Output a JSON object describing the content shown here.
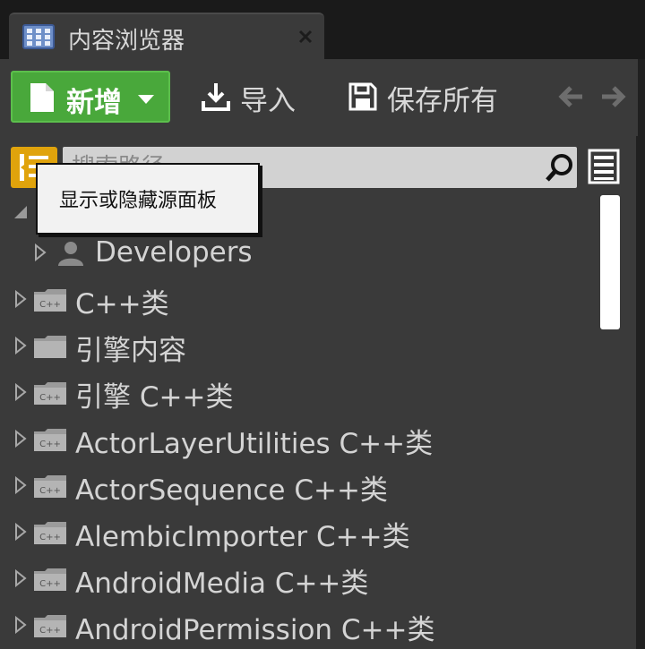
{
  "tab": {
    "title": "内容浏览器"
  },
  "toolbar": {
    "new_label": "新增",
    "import_label": "导入",
    "save_all_label": "保存所有"
  },
  "search": {
    "placeholder": "搜索路径"
  },
  "tooltip": {
    "text": "显示或隐藏源面板"
  },
  "tree": {
    "developers": "Developers",
    "items": [
      {
        "label": "C++类",
        "icon": "cpp-folder-icon"
      },
      {
        "label": "引擎内容",
        "icon": "folder-icon"
      },
      {
        "label": "引擎 C++类",
        "icon": "cpp-folder-icon"
      },
      {
        "label": "ActorLayerUtilities C++类",
        "icon": "cpp-folder-icon"
      },
      {
        "label": "ActorSequence C++类",
        "icon": "cpp-folder-icon"
      },
      {
        "label": "AlembicImporter C++类",
        "icon": "cpp-folder-icon"
      },
      {
        "label": "AndroidMedia C++类",
        "icon": "cpp-folder-icon"
      },
      {
        "label": "AndroidPermission C++类",
        "icon": "cpp-folder-icon"
      }
    ]
  },
  "colors": {
    "accent_green": "#49a83b",
    "source_toggle": "#e0a30c",
    "panel_bg": "#3a3a3a",
    "tab_bar_bg": "#1a1a1a"
  }
}
